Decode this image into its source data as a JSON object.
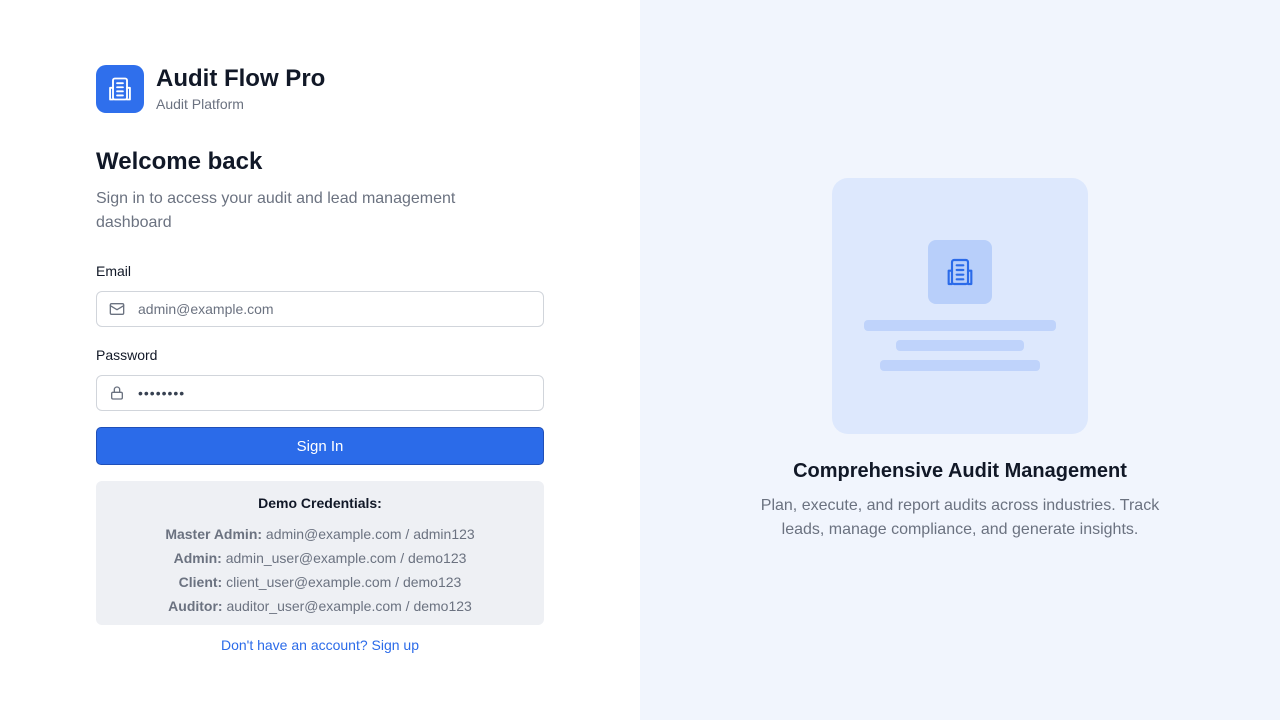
{
  "brand": {
    "name": "Audit Flow Pro",
    "subtitle": "Audit Platform",
    "icon": "building-icon"
  },
  "welcome": {
    "title": "Welcome back",
    "subtitle": "Sign in to access your audit and lead management dashboard"
  },
  "form": {
    "email_label": "Email",
    "email_placeholder": "admin@example.com",
    "email_icon": "mail-icon",
    "password_label": "Password",
    "password_value": "••••••••",
    "password_icon": "lock-icon",
    "submit_label": "Sign In"
  },
  "demo": {
    "title": "Demo Credentials:",
    "credentials": [
      {
        "role": "Master Admin:",
        "value": "admin@example.com / admin123"
      },
      {
        "role": "Admin:",
        "value": "admin_user@example.com / demo123"
      },
      {
        "role": "Client:",
        "value": "client_user@example.com / demo123"
      },
      {
        "role": "Auditor:",
        "value": "auditor_user@example.com / demo123"
      }
    ]
  },
  "signup": {
    "label": "Don't have an account? Sign up"
  },
  "promo": {
    "title": "Comprehensive Audit Management",
    "description": "Plan, execute, and report audits across industries. Track leads, manage compliance, and generate insights."
  },
  "colors": {
    "accent": "#2b6be9",
    "panel": "#f1f5fd",
    "illustration": "#dde8fd"
  }
}
